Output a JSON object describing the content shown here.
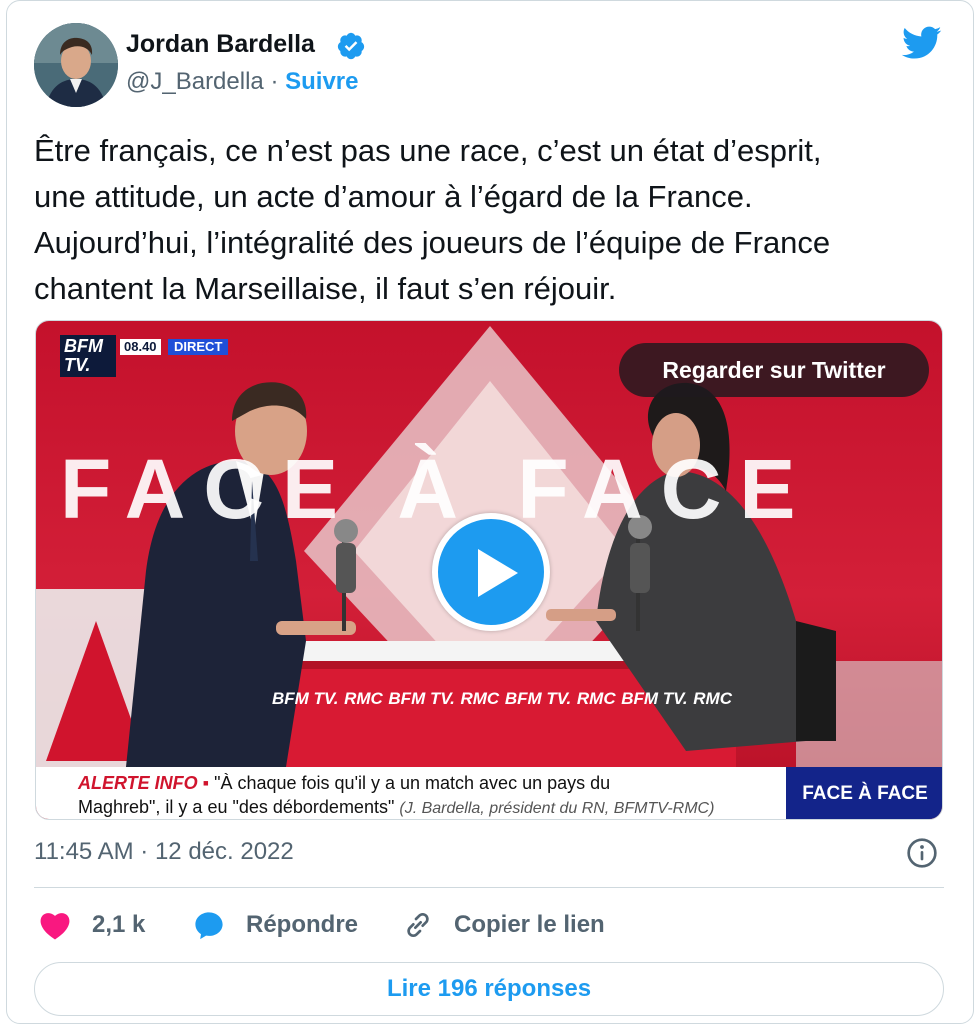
{
  "author": {
    "name": "Jordan Bardella",
    "handle": "@J_Bardella",
    "separator": "·",
    "follow_label": "Suivre"
  },
  "tweet": {
    "lines": [
      "Être français, ce n’est pas une race, c’est un état d’esprit,",
      "une attitude, un acte d’amour à l’égard de la France.",
      "Aujourd’hui, l’intégralité des joueurs de l’équipe de France",
      "chantent la Marseillaise, il faut s’en réjouir."
    ]
  },
  "media": {
    "watch_label": "Regarder sur Twitter",
    "channel_logo": "BFM TV.",
    "clock": "08.40",
    "live_label": "DIRECT",
    "set_text": "FACE À FACE",
    "desk_logos": [
      "BFM TV.",
      "RMC",
      "BFM TV.",
      "RMC",
      "BFM TV.",
      "RMC",
      "BFM TV.",
      "RMC"
    ],
    "ticker_alert": "ALERTE INFO ▪",
    "ticker_line1": "\"À chaque fois qu'il y a un match avec un pays du",
    "ticker_line2": "Maghreb\", il y a eu \"des débordements\"",
    "ticker_credit": "(J. Bardella, président du RN, BFMTV-RMC)",
    "ticker_program": "FACE À FACE"
  },
  "meta": {
    "timestamp": "11:45 AM · 12 déc. 2022"
  },
  "actions": {
    "likes": "2,1 k",
    "reply_label": "Répondre",
    "copy_link_label": "Copier le lien"
  },
  "read_replies_label": "Lire 196 réponses",
  "colors": {
    "accent": "#1d9bf0",
    "like": "#f91880",
    "text": "#0f1419",
    "muted": "#536471",
    "border": "#cfd9de"
  },
  "icons": [
    "verified-badge-icon",
    "twitter-bird-icon",
    "play-icon",
    "info-icon",
    "heart-icon",
    "reply-icon",
    "link-icon"
  ]
}
